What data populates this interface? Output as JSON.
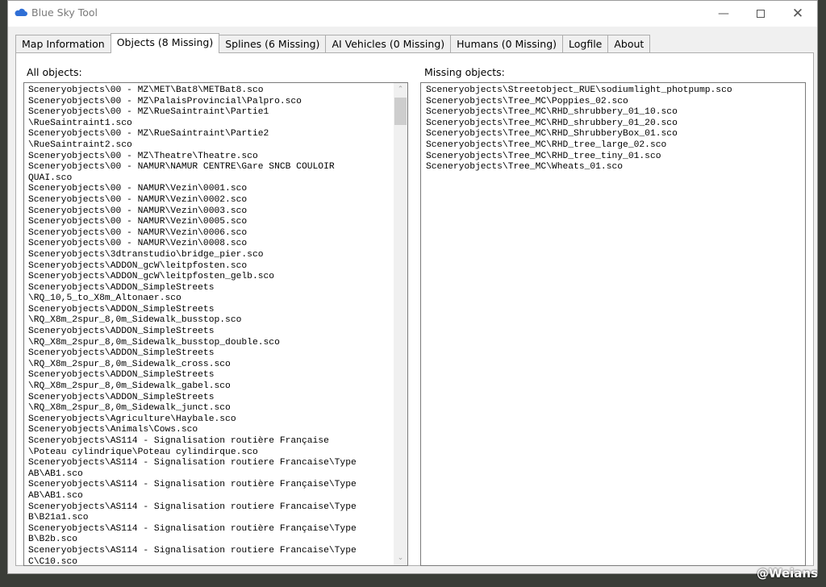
{
  "window": {
    "title": "Blue Sky Tool",
    "minimize_icon": "minimize-icon",
    "maximize_icon": "maximize-icon",
    "close_icon": "close-icon"
  },
  "tabs": [
    {
      "label": "Map Information"
    },
    {
      "label": "Objects (8 Missing)",
      "active": true
    },
    {
      "label": "Splines (6 Missing)"
    },
    {
      "label": "AI Vehicles (0 Missing)"
    },
    {
      "label": "Humans (0 Missing)"
    },
    {
      "label": "Logfile"
    },
    {
      "label": "About"
    }
  ],
  "all_objects": {
    "label": "All objects:",
    "lines": [
      "Sceneryobjects\\00 - MZ\\MET\\Bat8\\METBat8.sco",
      "Sceneryobjects\\00 - MZ\\PalaisProvincial\\Palpro.sco",
      "Sceneryobjects\\00 - MZ\\RueSaintraint\\Partie1",
      "\\RueSaintraint1.sco",
      "Sceneryobjects\\00 - MZ\\RueSaintraint\\Partie2",
      "\\RueSaintraint2.sco",
      "Sceneryobjects\\00 - MZ\\Theatre\\Theatre.sco",
      "Sceneryobjects\\00 - NAMUR\\NAMUR CENTRE\\Gare SNCB COULOIR",
      "QUAI.sco",
      "Sceneryobjects\\00 - NAMUR\\Vezin\\0001.sco",
      "Sceneryobjects\\00 - NAMUR\\Vezin\\0002.sco",
      "Sceneryobjects\\00 - NAMUR\\Vezin\\0003.sco",
      "Sceneryobjects\\00 - NAMUR\\Vezin\\0005.sco",
      "Sceneryobjects\\00 - NAMUR\\Vezin\\0006.sco",
      "Sceneryobjects\\00 - NAMUR\\Vezin\\0008.sco",
      "Sceneryobjects\\3dtranstudio\\bridge_pier.sco",
      "Sceneryobjects\\ADDON_gcW\\leitpfosten.sco",
      "Sceneryobjects\\ADDON_gcW\\leitpfosten_gelb.sco",
      "Sceneryobjects\\ADDON_SimpleStreets",
      "\\RQ_10,5_to_X8m_Altonaer.sco",
      "Sceneryobjects\\ADDON_SimpleStreets",
      "\\RQ_X8m_2spur_8,0m_Sidewalk_busstop.sco",
      "Sceneryobjects\\ADDON_SimpleStreets",
      "\\RQ_X8m_2spur_8,0m_Sidewalk_busstop_double.sco",
      "Sceneryobjects\\ADDON_SimpleStreets",
      "\\RQ_X8m_2spur_8,0m_Sidewalk_cross.sco",
      "Sceneryobjects\\ADDON_SimpleStreets",
      "\\RQ_X8m_2spur_8,0m_Sidewalk_gabel.sco",
      "Sceneryobjects\\ADDON_SimpleStreets",
      "\\RQ_X8m_2spur_8,0m_Sidewalk_junct.sco",
      "Sceneryobjects\\Agriculture\\Haybale.sco",
      "Sceneryobjects\\Animals\\Cows.sco",
      "Sceneryobjects\\AS114 - Signalisation routière Française",
      "\\Poteau cylindrique\\Poteau cylindirque.sco",
      "Sceneryobjects\\AS114 - Signalisation routiere Francaise\\Type",
      "AB\\AB1.sco",
      "Sceneryobjects\\AS114 - Signalisation routière Française\\Type",
      "AB\\AB1.sco",
      "Sceneryobjects\\AS114 - Signalisation routiere Francaise\\Type",
      "B\\B21a1.sco",
      "Sceneryobjects\\AS114 - Signalisation routière Française\\Type",
      "B\\B2b.sco",
      "Sceneryobjects\\AS114 - Signalisation routiere Francaise\\Type",
      "C\\C10.sco"
    ]
  },
  "missing_objects": {
    "label": "Missing objects:",
    "lines": [
      "Sceneryobjects\\Streetobject_RUE\\sodiumlight_photpump.sco",
      "Sceneryobjects\\Tree_MC\\Poppies_02.sco",
      "Sceneryobjects\\Tree_MC\\RHD_shrubbery_01_10.sco",
      "Sceneryobjects\\Tree_MC\\RHD_shrubbery_01_20.sco",
      "Sceneryobjects\\Tree_MC\\RHD_ShrubberyBox_01.sco",
      "Sceneryobjects\\Tree_MC\\RHD_tree_large_02.sco",
      "Sceneryobjects\\Tree_MC\\RHD_tree_tiny_01.sco",
      "Sceneryobjects\\Tree_MC\\Wheats_01.sco"
    ]
  },
  "watermark": "@Weians",
  "colors": {
    "accent": "#2f6fd6",
    "window_bg": "#f0f0f0"
  }
}
